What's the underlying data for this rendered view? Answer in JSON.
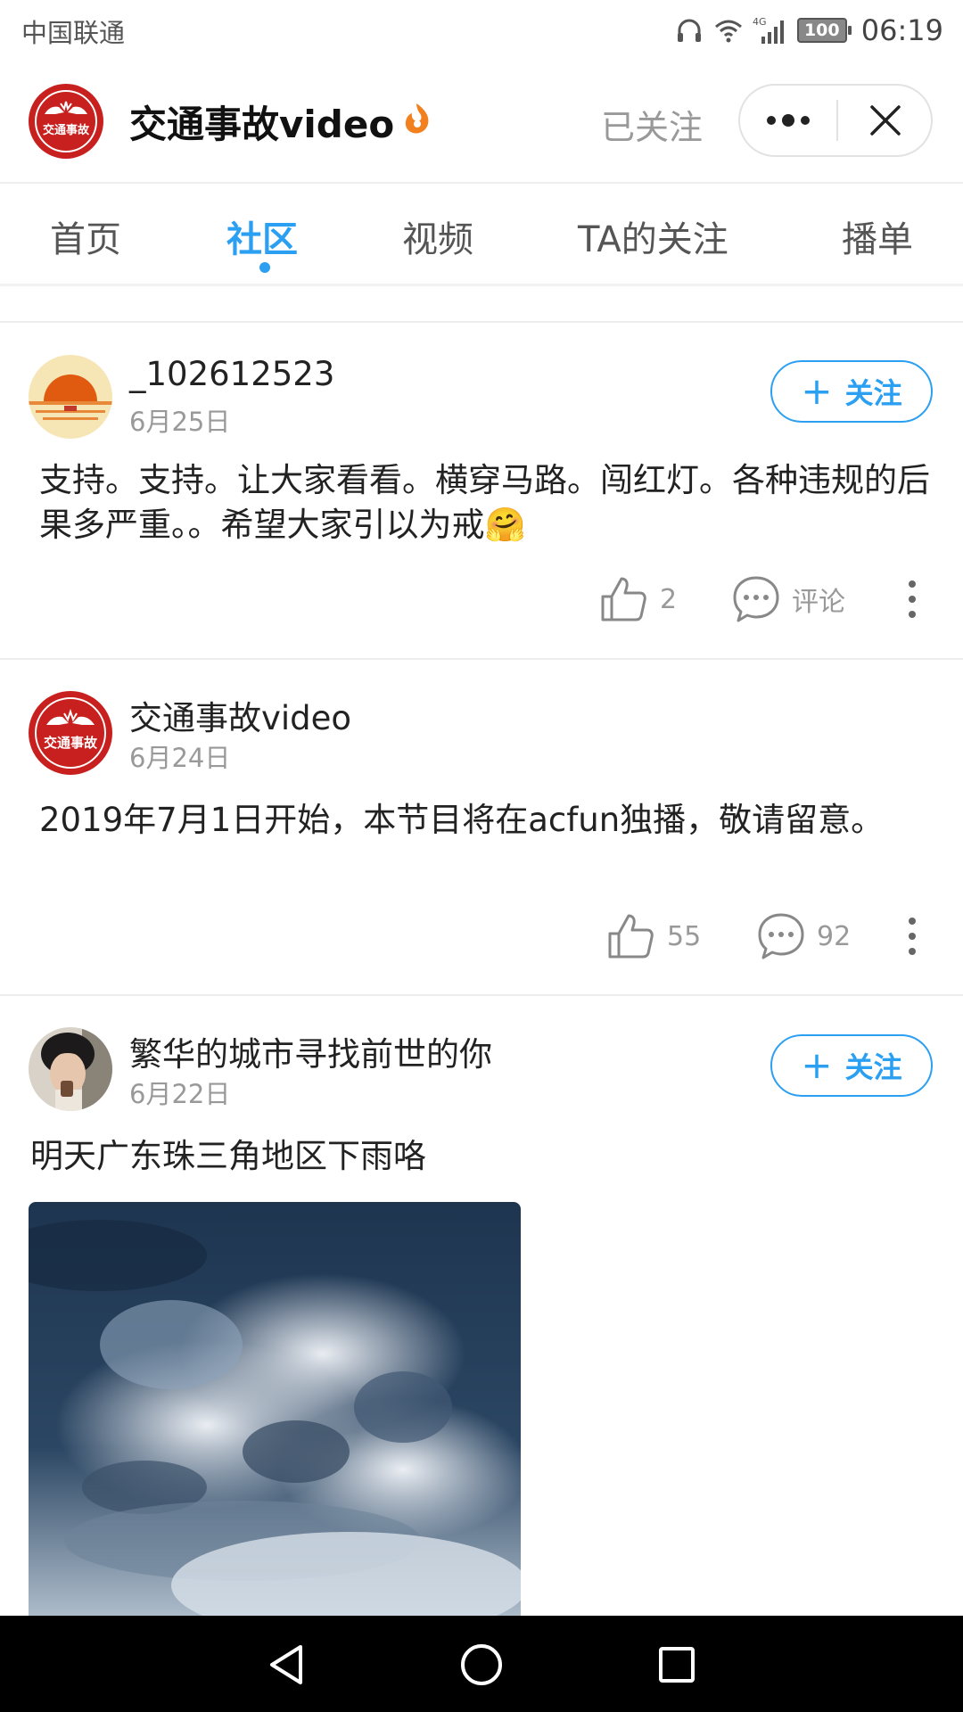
{
  "status_bar": {
    "carrier": "中国联通",
    "network": "4G",
    "battery": "100",
    "time": "06:19"
  },
  "header": {
    "title": "交通事故video",
    "follow_status": "已关注",
    "avatar_text": "交通事故",
    "icons": [
      "flame-badge-icon",
      "more-dots-icon",
      "close-icon"
    ]
  },
  "tabs": [
    {
      "label": "首页",
      "active": false
    },
    {
      "label": "社区",
      "active": true
    },
    {
      "label": "视频",
      "active": false
    },
    {
      "label": "TA的关注",
      "active": false
    },
    {
      "label": "播单",
      "active": false
    }
  ],
  "posts": [
    {
      "username": "_102612523",
      "date": "6月25日",
      "follow_label": "关注",
      "content": "支持。支持。让大家看看。横穿马路。闯红灯。各种违规的后果多严重。。希望大家引以为戒🤗",
      "likes": "2",
      "comments": "评论"
    },
    {
      "username": "交通事故video",
      "date": "6月24日",
      "content": "2019年7月1日开始，本节目将在acfun独播，敬请留意。",
      "likes": "55",
      "comments": "92"
    },
    {
      "username": "繁华的城市寻找前世的你",
      "date": "6月22日",
      "follow_label": "关注",
      "content": "明天广东珠三角地区下雨咯"
    }
  ],
  "colors": {
    "accent": "#2b9ff2",
    "brand_red": "#c8201e",
    "muted": "#999999"
  }
}
